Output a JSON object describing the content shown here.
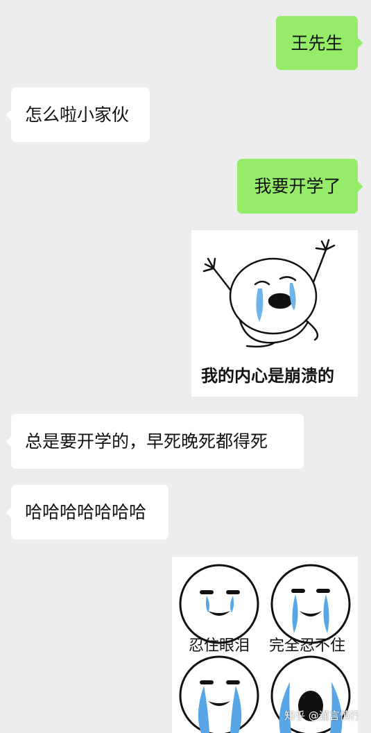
{
  "messages": [
    {
      "side": "right",
      "text": "王先生"
    },
    {
      "side": "left",
      "text": "怎么啦小家伙"
    },
    {
      "side": "right",
      "text": "我要开学了"
    },
    {
      "side": "right",
      "sticker": "crying-collapse-meme",
      "caption": "我的内心是崩溃的"
    },
    {
      "side": "left",
      "text": "总是要开学的，早死晚死都得死"
    },
    {
      "side": "left",
      "text": "哈哈哈哈哈哈哈"
    },
    {
      "side": "right",
      "sticker": "four-panel-crying-meme",
      "captions": [
        "忍住眼泪",
        "完全忍不住"
      ]
    }
  ],
  "watermark": {
    "text": "知乎 @谨言慎行"
  },
  "colors": {
    "background": "#ededed",
    "sent_bubble": "#95ec69",
    "received_bubble": "#ffffff"
  }
}
